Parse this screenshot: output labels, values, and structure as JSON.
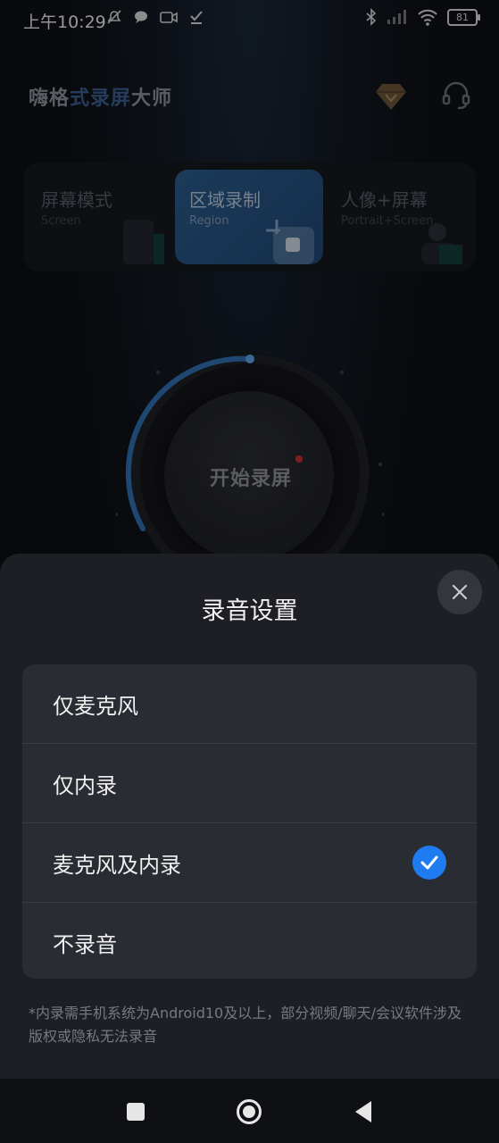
{
  "status_bar": {
    "time": "上午10:29",
    "battery": "81",
    "icons_left": [
      "mute-icon",
      "chat-icon",
      "video-icon",
      "check-download-icon"
    ],
    "icons_right": [
      "bluetooth-icon",
      "signal-icon",
      "wifi-icon",
      "battery-icon"
    ]
  },
  "app": {
    "title_part1": "嗨格",
    "title_part2": "式",
    "title_part3": "录屏",
    "title_part4": "大师",
    "modes": [
      {
        "label": "屏幕模式",
        "sub": "Screen"
      },
      {
        "label": "区域录制",
        "sub": "Region",
        "selected": true
      },
      {
        "label": "人像+屏幕",
        "sub": "Portrait+Screen"
      }
    ],
    "record_button": "开始录屏"
  },
  "sheet": {
    "title": "录音设置",
    "options": [
      {
        "label": "仅麦克风",
        "checked": false
      },
      {
        "label": "仅内录",
        "checked": false
      },
      {
        "label": "麦克风及内录",
        "checked": true
      },
      {
        "label": "不录音",
        "checked": false
      }
    ],
    "note": "*内录需手机系统为Android10及以上，部分视频/聊天/会议软件涉及版权或隐私无法录音"
  },
  "colors": {
    "accent": "#1f7bf0",
    "sheet_bg": "#1d1f24",
    "option_bg": "#2a2c33",
    "region_card": "#2b5a8a"
  }
}
